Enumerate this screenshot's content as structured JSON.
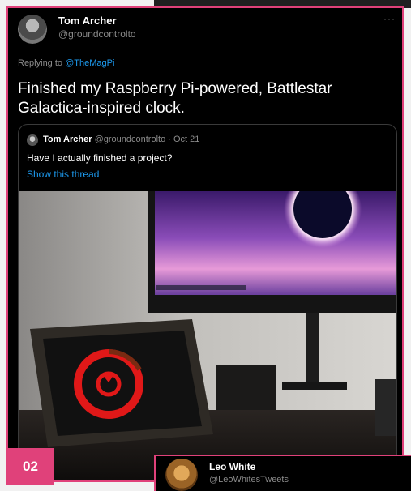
{
  "tweet": {
    "author_name": "Tom Archer",
    "author_handle": "@groundcontrolto",
    "more_icon": "more-icon",
    "replying_prefix": "Replying to",
    "replying_mention": "@TheMagPi",
    "text": "Finished my Raspberry Pi-powered, Battlestar Galactica-inspired clock."
  },
  "quoted": {
    "author_name": "Tom Archer",
    "author_handle": "@groundcontrolto",
    "separator": "·",
    "date": "Oct 21",
    "text": "Have I actually finished a project?",
    "show_thread": "Show this thread"
  },
  "badge": "02",
  "next_tweet": {
    "author_name": "Leo White",
    "author_handle": "@LeoWhitesTweets"
  },
  "colors": {
    "accent": "#e0417a",
    "link": "#1d9bf0",
    "clock_red": "#e01818"
  }
}
